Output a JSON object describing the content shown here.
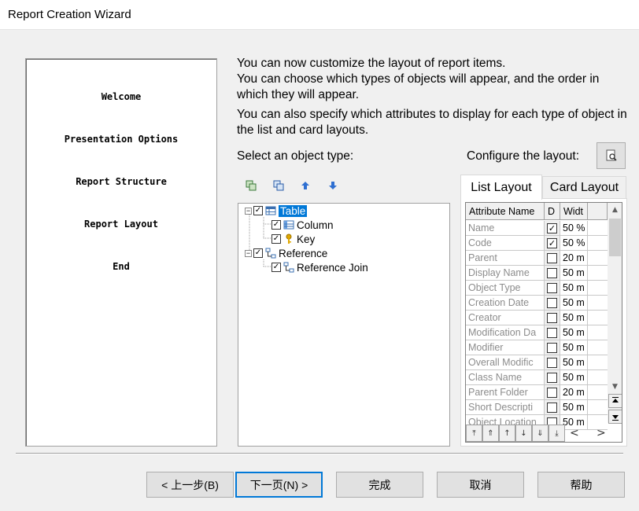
{
  "window": {
    "title": "Report Creation Wizard"
  },
  "steps": [
    "Welcome",
    "Presentation Options",
    "Report Structure",
    "Report Layout",
    "End"
  ],
  "intro": {
    "line1": "You can now customize the layout of report items.",
    "line2": "You can choose which types of objects will appear, and the order in which they will appear.",
    "line3": "You can also specify which attributes to display for each type of object in the list and card layouts."
  },
  "labels": {
    "select_object_type": "Select an object type:",
    "configure_layout": "Configure the layout:"
  },
  "tree": {
    "table": "Table",
    "column": "Column",
    "key": "Key",
    "reference": "Reference",
    "reference_join": "Reference Join"
  },
  "tabs": {
    "list": "List Layout",
    "card": "Card Layout"
  },
  "grid": {
    "headers": {
      "name": "Attribute Name",
      "d": "D",
      "width": "Widt"
    },
    "rows": [
      {
        "name": "Name",
        "checked": true,
        "width": "50 %"
      },
      {
        "name": "Code",
        "checked": true,
        "width": "50 %"
      },
      {
        "name": "Parent",
        "checked": false,
        "width": "20 m"
      },
      {
        "name": "Display Name",
        "checked": false,
        "width": "50 m"
      },
      {
        "name": "Object Type",
        "checked": false,
        "width": "50 m"
      },
      {
        "name": "Creation Date",
        "checked": false,
        "width": "50 m"
      },
      {
        "name": "Creator",
        "checked": false,
        "width": "50 m"
      },
      {
        "name": "Modification Da",
        "checked": false,
        "width": "50 m"
      },
      {
        "name": "Modifier",
        "checked": false,
        "width": "50 m"
      },
      {
        "name": "Overall Modific",
        "checked": false,
        "width": "50 m"
      },
      {
        "name": "Class Name",
        "checked": false,
        "width": "50 m"
      },
      {
        "name": "Parent Folder",
        "checked": false,
        "width": "20 m"
      },
      {
        "name": "Short Descripti",
        "checked": false,
        "width": "50 m"
      },
      {
        "name": "Object Location",
        "checked": false,
        "width": "50 m"
      }
    ]
  },
  "buttons": {
    "back": "< 上一步(B)",
    "next": "下一页(N) >",
    "finish": "完成",
    "cancel": "取消",
    "help": "帮助"
  },
  "colors": {
    "selection": "#0078d7",
    "window_bg": "#f0f0f0"
  }
}
